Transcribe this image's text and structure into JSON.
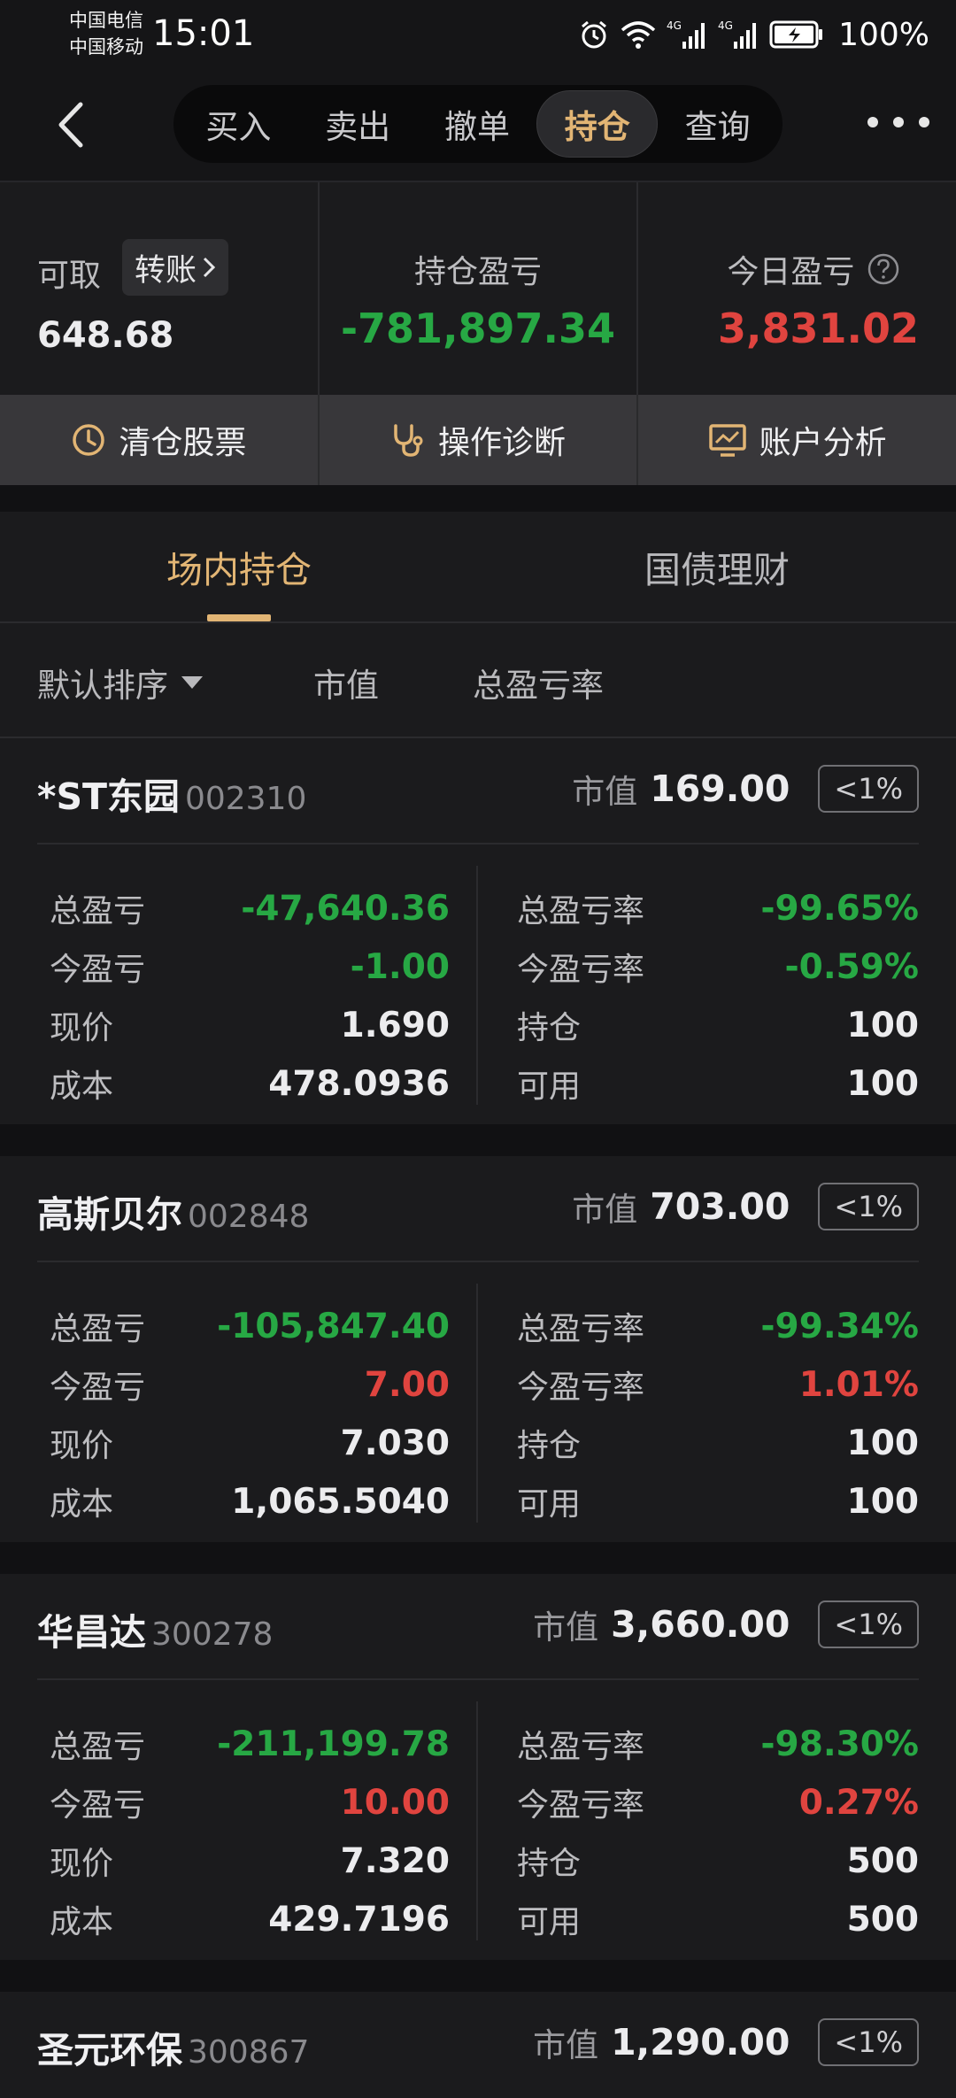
{
  "status_bar": {
    "carrier1": "中国电信",
    "carrier2": "中国移动",
    "time": "15:01",
    "battery": "100%",
    "icons": [
      "alarm-icon",
      "wifi-icon",
      "signal-4g-icon",
      "signal-4g-icon",
      "battery-charging-icon"
    ]
  },
  "nav": {
    "tabs": [
      {
        "label": "买入",
        "active": false
      },
      {
        "label": "卖出",
        "active": false
      },
      {
        "label": "撤单",
        "active": false
      },
      {
        "label": "持仓",
        "active": true
      },
      {
        "label": "查询",
        "active": false
      }
    ]
  },
  "summary": {
    "available_label": "可取",
    "transfer_label": "转账",
    "available_value": "648.68",
    "holding_pl_label": "持仓盈亏",
    "holding_pl_value": "-781,897.34",
    "today_pl_label": "今日盈亏",
    "today_pl_value": "3,831.02"
  },
  "actions": [
    {
      "label": "清仓股票",
      "icon": "clock-icon"
    },
    {
      "label": "操作诊断",
      "icon": "stethoscope-icon"
    },
    {
      "label": "账户分析",
      "icon": "chart-monitor-icon"
    }
  ],
  "tabs": {
    "in_market": "场内持仓",
    "bonds": "国债理财"
  },
  "sort": {
    "default": "默认排序",
    "market_value": "市值",
    "total_rate": "总盈亏率"
  },
  "labels": {
    "market_value": "市值",
    "total_pl": "总盈亏",
    "today_pl": "今盈亏",
    "price": "现价",
    "cost": "成本",
    "total_pl_rate": "总盈亏率",
    "today_pl_rate": "今盈亏率",
    "position": "持仓",
    "available": "可用"
  },
  "colors": {
    "accent": "#e2b574",
    "loss_green": "#27a844",
    "gain_red": "#e0443f"
  },
  "stocks": [
    {
      "name": "*ST东园",
      "code": "002310",
      "market_value": "169.00",
      "weight": "<1%",
      "total_pl": "-47,640.36",
      "today_pl": "-1.00",
      "price": "1.690",
      "cost": "478.0936",
      "total_pl_rate": "-99.65%",
      "today_pl_rate": "-0.59%",
      "position": "100",
      "available": "100"
    },
    {
      "name": "高斯贝尔",
      "code": "002848",
      "market_value": "703.00",
      "weight": "<1%",
      "total_pl": "-105,847.40",
      "today_pl": "7.00",
      "price": "7.030",
      "cost": "1,065.5040",
      "total_pl_rate": "-99.34%",
      "today_pl_rate": "1.01%",
      "position": "100",
      "available": "100"
    },
    {
      "name": "华昌达",
      "code": "300278",
      "market_value": "3,660.00",
      "weight": "<1%",
      "total_pl": "-211,199.78",
      "today_pl": "10.00",
      "price": "7.320",
      "cost": "429.7196",
      "total_pl_rate": "-98.30%",
      "today_pl_rate": "0.27%",
      "position": "500",
      "available": "500"
    },
    {
      "name": "圣元环保",
      "code": "300867",
      "market_value": "1,290.00",
      "weight": "<1%"
    }
  ]
}
